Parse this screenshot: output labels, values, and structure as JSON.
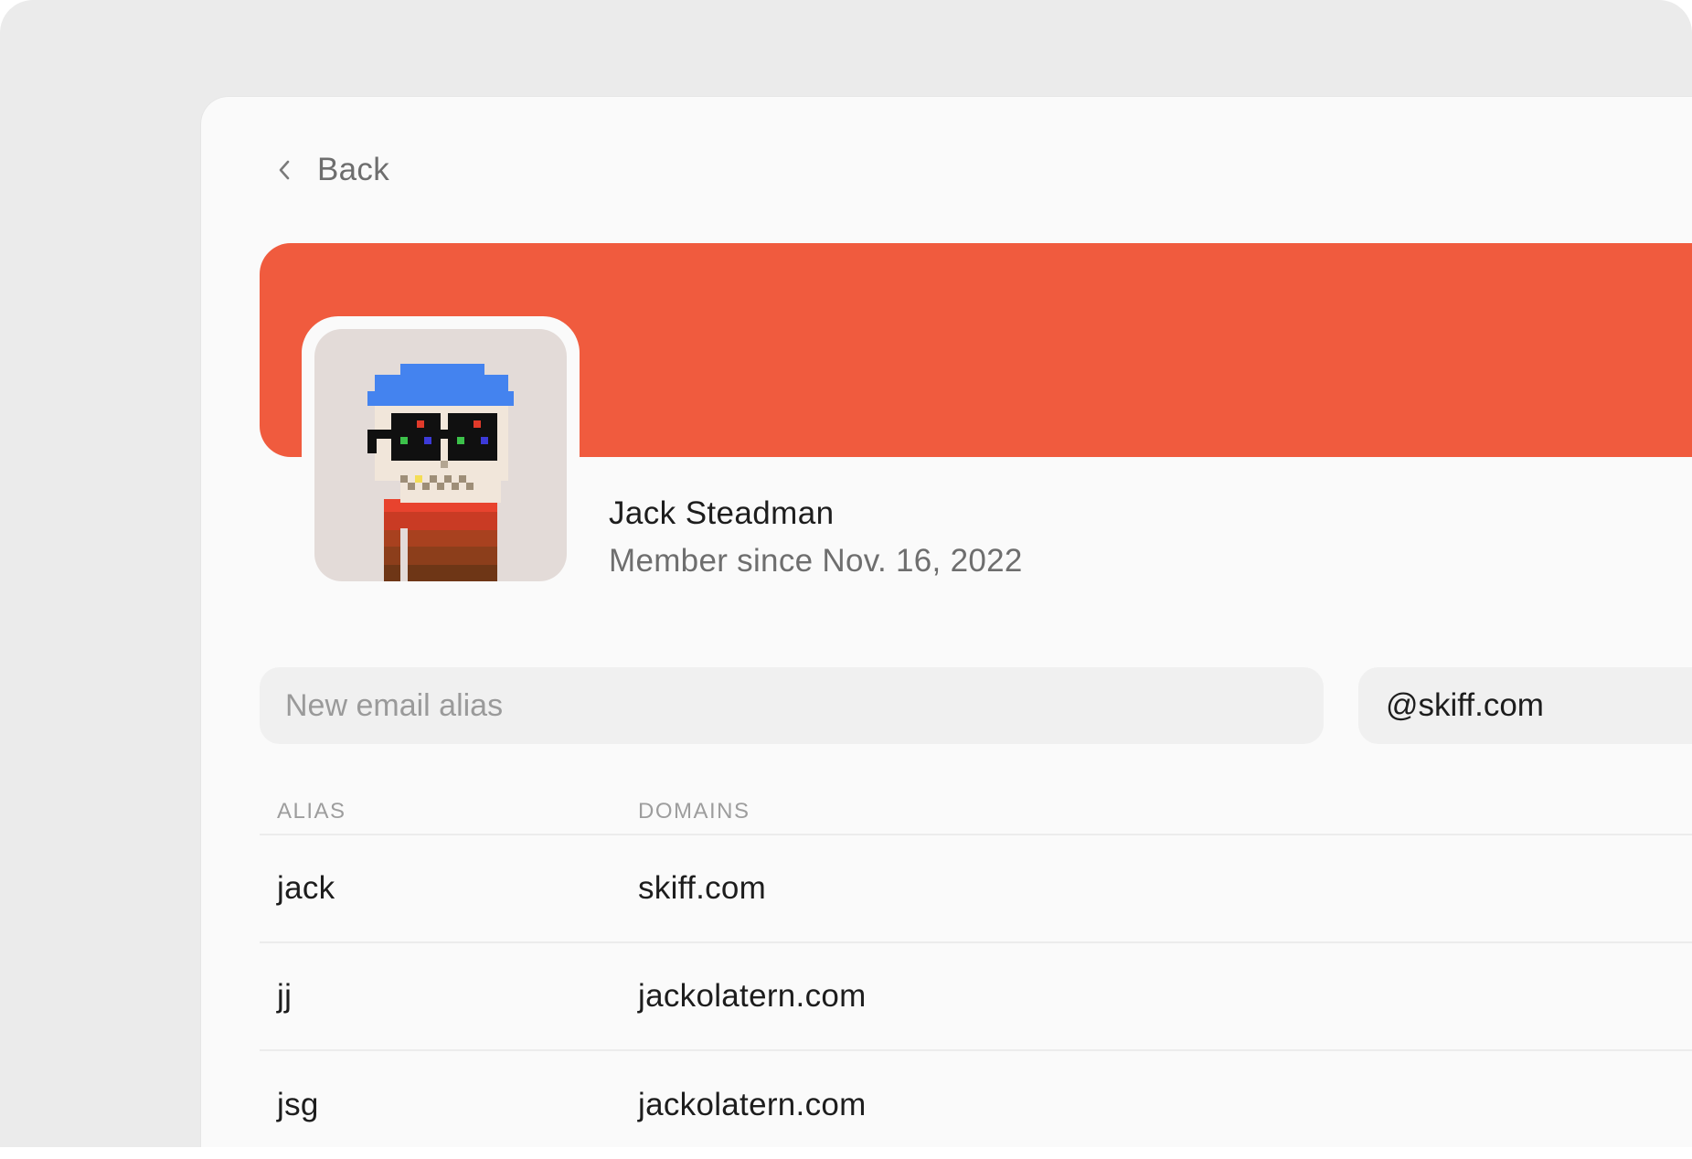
{
  "nav": {
    "back_label": "Back"
  },
  "profile": {
    "name": "Jack Steadman",
    "member_since": "Member since Nov. 16, 2022",
    "banner_color": "#f05b3e"
  },
  "alias_form": {
    "input_placeholder": "New email alias",
    "input_value": "",
    "domain_selected": "@skiff.com"
  },
  "alias_table": {
    "headers": {
      "alias": "ALIAS",
      "domains": "DOMAINS"
    },
    "rows": [
      {
        "alias": "jack",
        "domain": "skiff.com"
      },
      {
        "alias": "jj",
        "domain": "jackolatern.com"
      },
      {
        "alias": "jsg",
        "domain": "jackolatern.com"
      }
    ]
  }
}
